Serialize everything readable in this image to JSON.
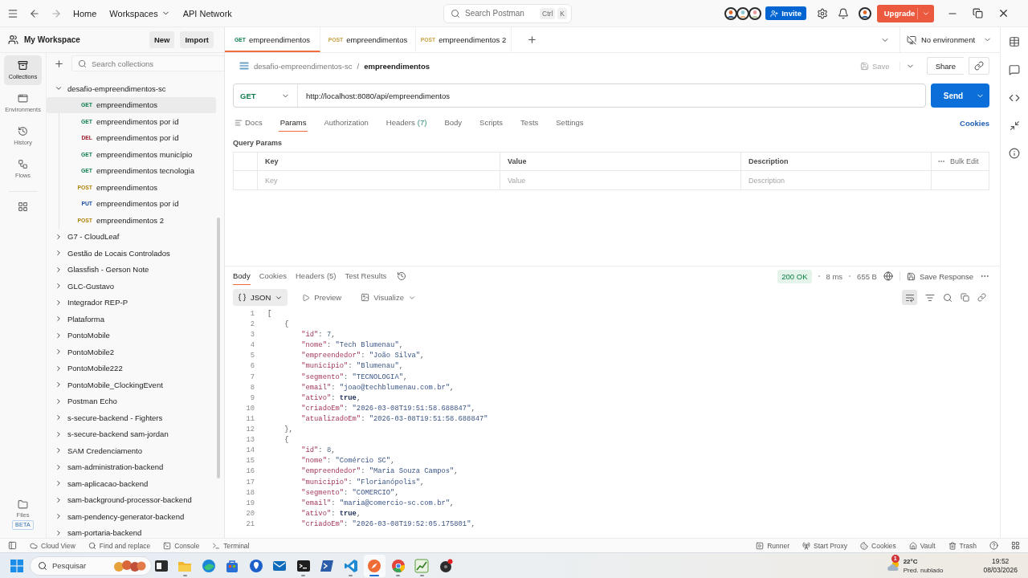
{
  "top_bar": {
    "nav": [
      {
        "label": "Home",
        "has_menu": false
      },
      {
        "label": "Workspaces",
        "has_menu": true
      },
      {
        "label": "API Network",
        "has_menu": false
      }
    ],
    "search": {
      "placeholder": "Search Postman",
      "shortcut": [
        "Ctrl",
        "K"
      ]
    },
    "invite": "Invite",
    "upgrade": "Upgrade"
  },
  "workspace": {
    "title": "My Workspace",
    "buttons": [
      "New",
      "Import"
    ]
  },
  "rail": {
    "items": [
      {
        "label": "Collections",
        "selected": true
      },
      {
        "label": "Environments",
        "selected": false
      },
      {
        "label": "History",
        "selected": false
      },
      {
        "label": "Flows",
        "selected": false
      }
    ],
    "files": {
      "label": "Files",
      "badge": "BETA"
    }
  },
  "collections": {
    "search": {
      "placeholder": "Search collections"
    },
    "items": [
      {
        "name": "desafio-empreendimentos-sc",
        "expanded": true,
        "children": [
          {
            "method": "GET",
            "color": "#0f7d4e",
            "name": "empreendimentos",
            "selected": true
          },
          {
            "method": "GET",
            "color": "#0f7d4e",
            "name": "empreendimentos por id",
            "selected": false
          },
          {
            "method": "DEL",
            "color": "#9b1c2c",
            "name": "empreendimentos por id",
            "selected": false
          },
          {
            "method": "GET",
            "color": "#0f7d4e",
            "name": "empreendimentos município",
            "selected": false
          },
          {
            "method": "GET",
            "color": "#0f7d4e",
            "name": "empreendimentos tecnologia",
            "selected": false
          },
          {
            "method": "POST",
            "color": "#b08308",
            "name": "empreendimentos",
            "selected": false
          },
          {
            "method": "PUT",
            "color": "#1d4fa3",
            "name": "empreendimentos por id",
            "selected": false
          },
          {
            "method": "POST",
            "color": "#b08308",
            "name": "empreendimentos 2",
            "selected": false
          }
        ]
      },
      {
        "name": "G7 - CloudLeaf",
        "expanded": false
      },
      {
        "name": "Gestão de Locais Controlados",
        "expanded": false
      },
      {
        "name": "Glassfish - Gerson Note",
        "expanded": false
      },
      {
        "name": "GLC-Gustavo",
        "expanded": false
      },
      {
        "name": "Integrador REP-P",
        "expanded": false
      },
      {
        "name": "Plataforma",
        "expanded": false
      },
      {
        "name": "PontoMobile",
        "expanded": false
      },
      {
        "name": "PontoMobile2",
        "expanded": false
      },
      {
        "name": "PontoMobile222",
        "expanded": false
      },
      {
        "name": "PontoMobile_ClockingEvent",
        "expanded": false
      },
      {
        "name": "Postman Echo",
        "expanded": false
      },
      {
        "name": "s-secure-backend - Fighters",
        "expanded": false
      },
      {
        "name": "s-secure-backend sam-jordan",
        "expanded": false
      },
      {
        "name": "SAM Credenciamento",
        "expanded": false
      },
      {
        "name": "sam-administration-backend",
        "expanded": false
      },
      {
        "name": "sam-aplicacao-backend",
        "expanded": false
      },
      {
        "name": "sam-background-processor-backend",
        "expanded": false
      },
      {
        "name": "sam-pendency-generator-backend",
        "expanded": false
      },
      {
        "name": "sam-portaria-backend",
        "expanded": false
      }
    ]
  },
  "tabs": [
    {
      "method": "GET",
      "color": "#0f7d4e",
      "label": "empreendimentos",
      "selected": true
    },
    {
      "method": "POST",
      "color": "#c9a247",
      "label": "empreendimentos",
      "selected": false
    },
    {
      "method": "POST",
      "color": "#c9a247",
      "label": "empreendimentos 2",
      "selected": false
    }
  ],
  "environment": "No environment",
  "request": {
    "breadcrumb": {
      "parent": "desafio-empreendimentos-sc",
      "separator": "/",
      "current": "empreendimentos"
    },
    "save": {
      "label": "Save",
      "disabled": true
    },
    "share": "Share",
    "method": "GET",
    "url": "http://localhost:8080/api/empreendimentos",
    "send": "Send",
    "tabs": [
      {
        "kind": "docs",
        "label": "Docs",
        "selected": false
      },
      {
        "kind": "tab",
        "label": "Params",
        "selected": true
      },
      {
        "kind": "tab",
        "label": "Authorization",
        "selected": false
      },
      {
        "kind": "tab",
        "label": "Headers",
        "count": "(7)",
        "selected": false
      },
      {
        "kind": "tab",
        "label": "Body",
        "selected": false
      },
      {
        "kind": "tab",
        "label": "Scripts",
        "selected": false
      },
      {
        "kind": "tab",
        "label": "Tests",
        "selected": false
      },
      {
        "kind": "tab",
        "label": "Settings",
        "selected": false
      }
    ],
    "cookies": "Cookies",
    "params": {
      "title": "Query Params",
      "columns": [
        "Key",
        "Value",
        "Description"
      ],
      "bulk_edit": "Bulk Edit",
      "placeholders": [
        "Key",
        "Value",
        "Description"
      ]
    }
  },
  "response": {
    "tabs": [
      {
        "label": "Body",
        "selected": true
      },
      {
        "label": "Cookies",
        "selected": false
      },
      {
        "label": "Headers",
        "count": "(5)",
        "selected": false
      },
      {
        "label": "Test Results",
        "selected": false
      }
    ],
    "status": "200 OK",
    "time": "8 ms",
    "size": "655 B",
    "save_response": "Save Response",
    "formats": [
      {
        "kind": "select",
        "label": "JSON",
        "selected": true
      },
      {
        "kind": "preview",
        "label": "Preview",
        "selected": false
      },
      {
        "kind": "visualize",
        "label": "Visualize",
        "selected": false
      }
    ],
    "line_wrap": true,
    "lines": [
      {
        "number": "1",
        "text": "["
      },
      {
        "number": "2",
        "text": "    {"
      },
      {
        "number": "3",
        "text": "        \"id\": 7,"
      },
      {
        "number": "4",
        "text": "        \"nome\": \"Tech Blumenau\","
      },
      {
        "number": "5",
        "text": "        \"empreendedor\": \"João Silva\","
      },
      {
        "number": "6",
        "text": "        \"municipio\": \"Blumenau\","
      },
      {
        "number": "7",
        "text": "        \"segmento\": \"TECNOLOGIA\","
      },
      {
        "number": "8",
        "text": "        \"email\": \"joao@techblumenau.com.br\","
      },
      {
        "number": "9",
        "text": "        \"ativo\": true,"
      },
      {
        "number": "10",
        "text": "        \"criadoEm\": \"2026-03-08T19:51:58.688847\","
      },
      {
        "number": "11",
        "text": "        \"atualizadoEm\": \"2026-03-08T19:51:58.688847\""
      },
      {
        "number": "12",
        "text": "    },"
      },
      {
        "number": "13",
        "text": "    {"
      },
      {
        "number": "14",
        "text": "        \"id\": 8,"
      },
      {
        "number": "15",
        "text": "        \"nome\": \"Comércio SC\","
      },
      {
        "number": "16",
        "text": "        \"empreendedor\": \"Maria Souza Campos\","
      },
      {
        "number": "17",
        "text": "        \"municipio\": \"Florianópolis\","
      },
      {
        "number": "18",
        "text": "        \"segmento\": \"COMERCIO\","
      },
      {
        "number": "19",
        "text": "        \"email\": \"maria@comercio-sc.com.br\","
      },
      {
        "number": "20",
        "text": "        \"ativo\": true,"
      },
      {
        "number": "21",
        "text": "        \"criadoEm\": \"2026-03-08T19:52:05.175801\","
      }
    ]
  },
  "status_bar": {
    "left": [
      "Cloud View",
      "Find and replace",
      "Console",
      "Terminal"
    ],
    "right": [
      "Runner",
      "Start Proxy",
      "Cookies",
      "Vault",
      "Trash"
    ]
  },
  "taskbar": {
    "search": {
      "placeholder": "Pesquisar"
    },
    "apps": [
      {
        "running": false,
        "selected": false
      },
      {
        "running": true,
        "selected": false
      },
      {
        "running": false,
        "selected": false
      },
      {
        "running": false,
        "selected": false
      },
      {
        "running": false,
        "selected": false
      },
      {
        "running": false,
        "selected": false
      },
      {
        "running": true,
        "selected": false
      },
      {
        "running": false,
        "selected": false
      },
      {
        "running": true,
        "selected": false
      },
      {
        "running": true,
        "selected": true
      },
      {
        "running": true,
        "selected": false
      },
      {
        "running": true,
        "selected": false
      },
      {
        "running": false,
        "selected": false
      }
    ],
    "weather": {
      "badge": "1",
      "temperature": "22°C",
      "condition": "Pred. nublado"
    },
    "time": "19:52",
    "date": "08/03/2026"
  }
}
